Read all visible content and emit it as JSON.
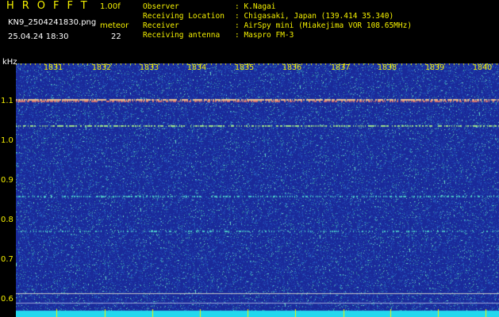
{
  "header": {
    "app_title": "HROFFT",
    "version": "1.00f",
    "filename": "KN9_2504241830.png",
    "meteor_label": "meteor",
    "datetime": "25.04.24 18:30",
    "meteor_count": "22"
  },
  "info": [
    {
      "key": "Observer",
      "value": ": K.Nagai"
    },
    {
      "key": "Receiving Location",
      "value": ": Chigasaki, Japan (139.414 35.340)"
    },
    {
      "key": "Receiver",
      "value": ": AirSpy mini (Miakejima VOR 108.65MHz)"
    },
    {
      "key": "Receiving antenna",
      "value": ": Maspro FM-3"
    }
  ],
  "spectrogram": {
    "y_unit": "kHz",
    "time_labels": [
      "1831",
      "1832",
      "1833",
      "1834",
      "1835",
      "1836",
      "1837",
      "1838",
      "1839",
      "1840"
    ],
    "freq_labels": [
      "1.1",
      "1.0",
      "0.9",
      "0.8",
      "0.7",
      "0.6"
    ],
    "background_color": "#1a2a9a",
    "label_color": "#f4f000"
  }
}
